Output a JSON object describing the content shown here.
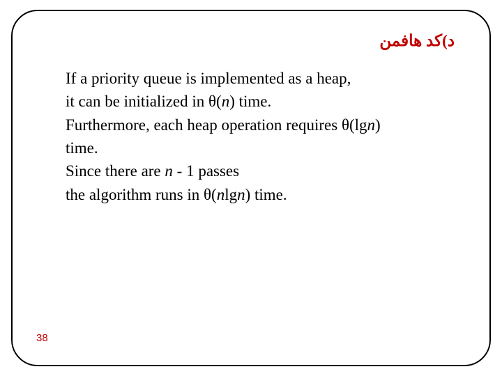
{
  "header": {
    "title": "د)کد هافمن"
  },
  "body": {
    "line1a": "If a priority queue is implemented as a heap,",
    "line2a": "it can be initialized in θ(",
    "line2b": "n",
    "line2c": ") time.",
    "line3a": "Furthermore, each heap operation requires θ(lg",
    "line3b": "n",
    "line3c": ")",
    "line4": "time.",
    "line5a": "Since there are ",
    "line5b": "n",
    "line5c": " - 1 passes",
    "line6a": "the algorithm runs in θ(",
    "line6b": "n",
    "line6c": "lg",
    "line6d": "n",
    "line6e": ") time."
  },
  "page": {
    "number": "38"
  }
}
